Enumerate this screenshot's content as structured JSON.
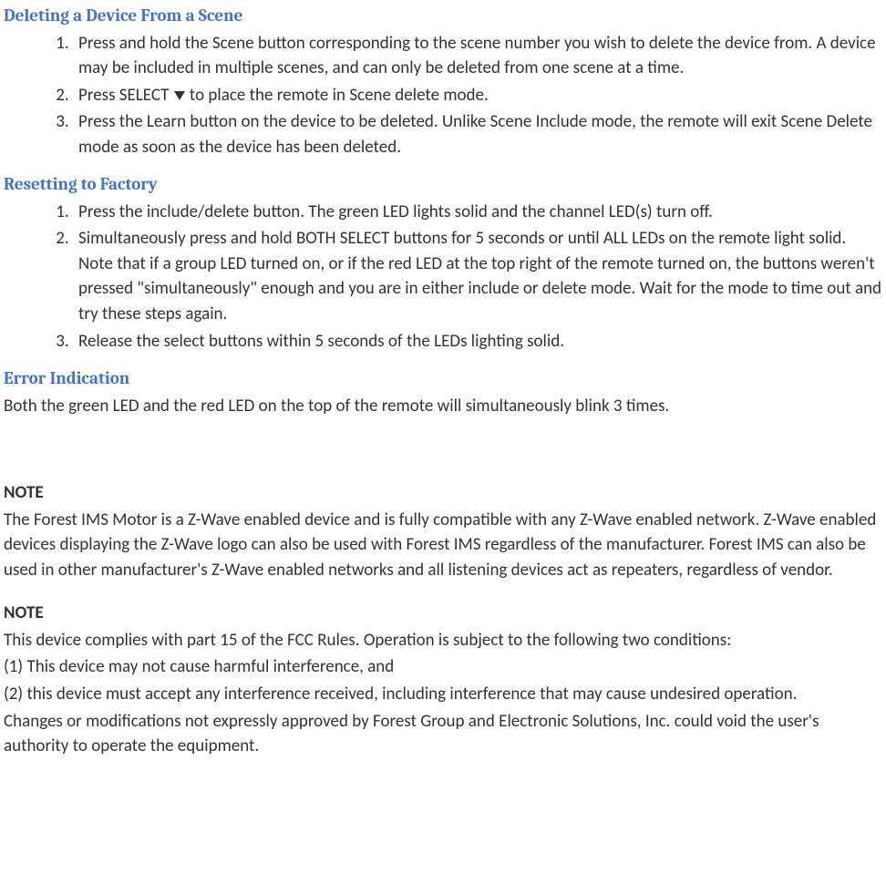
{
  "sections": {
    "delete_device": {
      "heading": "Deleting a Device From a Scene",
      "items": [
        "Press and hold the Scene button corresponding to the scene number you wish to delete the device from.  A device may be included in multiple scenes, and can only be deleted from one scene at a time.",
        {
          "pre": "Press SELECT ",
          "icon": "down-arrow",
          "post": " to place the remote in Scene delete mode."
        },
        "Press the Learn button on the device to be deleted.  Unlike Scene  Include mode, the remote will exit Scene Delete mode as soon as the device has been deleted."
      ]
    },
    "reset": {
      "heading": "Resetting to Factory",
      "items": [
        "Press the include/delete button.  The green LED lights solid and the channel LED(s) turn off.",
        {
          "pre": "Simultaneously press and hold BOTH ",
          "sc": "SELECT",
          "post": " buttons for 5 seconds or until ALL LEDs on the remote light solid.  Note that if a group LED turned on, or if the red LED at the top right of the remote turned on, the buttons weren't pressed \"simultaneously\" enough and you are in either include or delete mode.  Wait for the mode to time out and try these steps again."
        },
        "Release the select buttons within 5 seconds of the LEDs lighting solid."
      ]
    },
    "error": {
      "heading": "Error Indication",
      "body": "Both the green LED and the red LED on the top of the remote will simultaneously blink 3 times."
    }
  },
  "notes": [
    {
      "label": "NOTE",
      "body": " The Forest IMS Motor is a Z-Wave enabled device and is fully compatible with any Z-Wave enabled network. Z-Wave enabled devices displaying the Z-Wave logo can also be used with Forest IMS regardless of the manufacturer. Forest IMS can also be used in other manufacturer's Z-Wave enabled networks and all listening devices act as repeaters, regardless of vendor."
    },
    {
      "label": "NOTE",
      "lines": [
        "This device complies with part 15 of the FCC Rules. Operation is subject to the following two conditions:",
        "(1) This device may not cause harmful interference, and",
        "(2) this device must accept any interference received, including interference that may cause undesired operation.",
        "Changes or modifications not expressly approved by Forest Group and Electronic Solutions, Inc. could void the user's authority to operate the equipment."
      ]
    }
  ]
}
